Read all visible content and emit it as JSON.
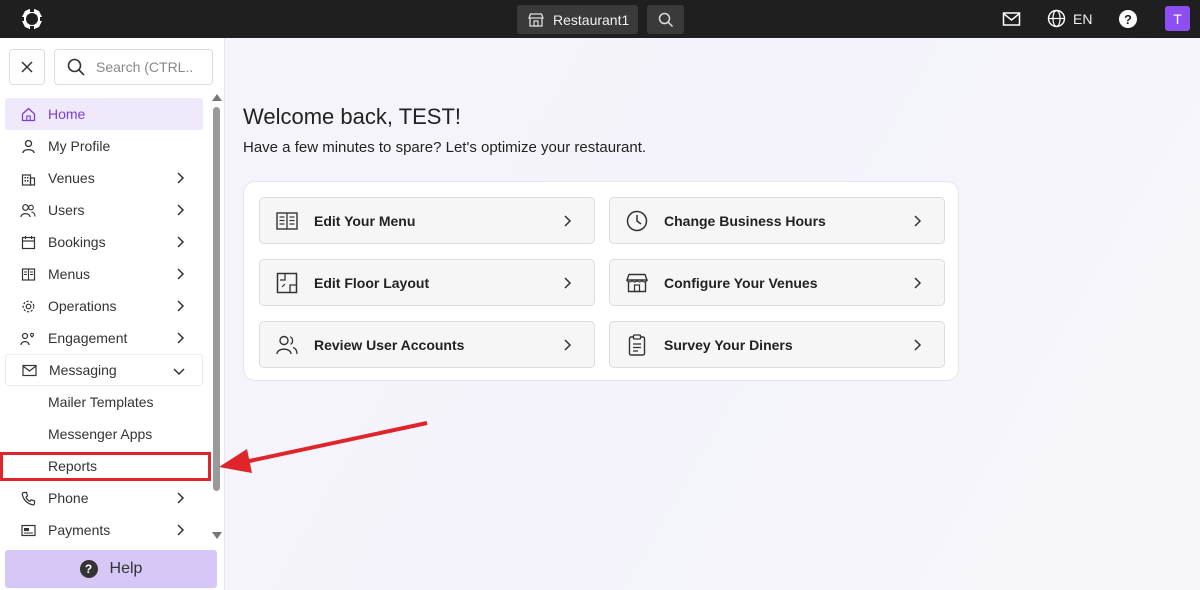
{
  "topbar": {
    "venue_label": "Restaurant1",
    "language": "EN",
    "help_symbol": "?",
    "avatar_initial": "T"
  },
  "sidebar": {
    "search_placeholder": "Search (CTRL...",
    "items": [
      {
        "label": "Home",
        "icon": "home-icon",
        "state": "active"
      },
      {
        "label": "My Profile",
        "icon": "user-icon"
      },
      {
        "label": "Venues",
        "icon": "building-icon"
      },
      {
        "label": "Users",
        "icon": "users-icon"
      },
      {
        "label": "Bookings",
        "icon": "calendar-icon"
      },
      {
        "label": "Menus",
        "icon": "menu-book-icon"
      },
      {
        "label": "Operations",
        "icon": "gear-icon"
      },
      {
        "label": "Engagement",
        "icon": "engagement-icon"
      },
      {
        "label": "Messaging",
        "icon": "mail-icon",
        "state": "expanded"
      },
      {
        "label": "Mailer Templates"
      },
      {
        "label": "Messenger Apps"
      },
      {
        "label": "Reports"
      },
      {
        "label": "Phone",
        "icon": "phone-icon"
      },
      {
        "label": "Payments",
        "icon": "payments-icon"
      }
    ],
    "help_label": "Help"
  },
  "main": {
    "welcome": "Welcome back, TEST!",
    "subtitle": "Have a few minutes to spare? Let's optimize your restaurant.",
    "actions": [
      {
        "label": "Edit Your Menu",
        "icon": "menu-book-icon"
      },
      {
        "label": "Change Business Hours",
        "icon": "clock-icon"
      },
      {
        "label": "Edit Floor Layout",
        "icon": "floor-layout-icon"
      },
      {
        "label": "Configure Your Venues",
        "icon": "storefront-icon"
      },
      {
        "label": "Review User Accounts",
        "icon": "users-icon"
      },
      {
        "label": "Survey Your Diners",
        "icon": "clipboard-icon"
      }
    ]
  },
  "colors": {
    "accent": "#8e4ff0",
    "active_bg": "#efe9fb",
    "highlight": "#e0242c",
    "topbar": "#1f1f1f"
  }
}
